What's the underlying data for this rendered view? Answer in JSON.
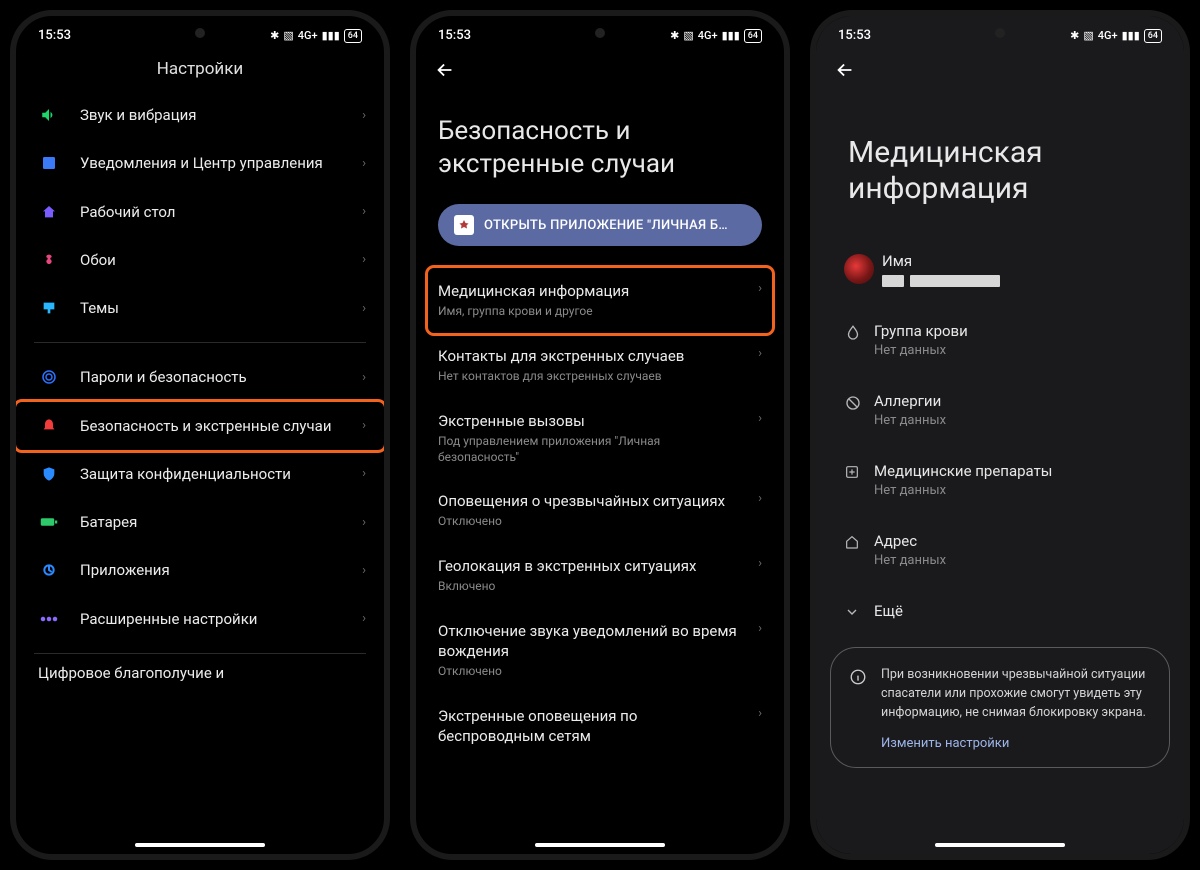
{
  "status": {
    "time": "15:53",
    "battery": "64",
    "net": "4G+"
  },
  "phone1": {
    "title": "Настройки",
    "items": [
      {
        "icon": "sound-icon",
        "color": "#1dd66a",
        "label": "Звук и вибрация"
      },
      {
        "icon": "notif-icon",
        "color": "#3a7af8",
        "label": "Уведомления и Центр управления"
      },
      {
        "icon": "home-icon",
        "color": "#7a5cff",
        "label": "Рабочий стол"
      },
      {
        "icon": "wallpaper-icon",
        "color": "#e6477f",
        "label": "Обои"
      },
      {
        "icon": "themes-icon",
        "color": "#29b6ff",
        "label": "Темы"
      }
    ],
    "items2": [
      {
        "icon": "fingerprint-icon",
        "color": "#2a72ff",
        "label": "Пароли и безопасность"
      },
      {
        "icon": "emergency-icon",
        "color": "#f23b3b",
        "label": "Безопасность и экстренные случаи",
        "highlight": true
      },
      {
        "icon": "shield-icon",
        "color": "#2a8aff",
        "label": "Защита конфиденциально­сти"
      },
      {
        "icon": "battery-icon",
        "color": "#2dc96a",
        "label": "Батарея"
      },
      {
        "icon": "apps-icon",
        "color": "#2a8aff",
        "label": "Приложения"
      },
      {
        "icon": "more-icon",
        "color": "#8b6bff",
        "label": "Расширенные настройки"
      }
    ],
    "cutoff": "Цифровое благополучие и"
  },
  "phone2": {
    "title": "Безопасность и экстренные случаи",
    "pill": "ОТКРЫТЬ ПРИЛОЖЕНИЕ \"ЛИЧНАЯ Б…",
    "items": [
      {
        "label": "Медицинская информация",
        "sub": "Имя, группа крови и другое",
        "highlight": true
      },
      {
        "label": "Контакты для экстренных случаев",
        "sub": "Нет контактов для экстренных случаев"
      },
      {
        "label": "Экстренные вызовы",
        "sub": "Под управлением приложения \"Личная безопасность\""
      },
      {
        "label": "Оповещения о чрезвычайных ситуациях",
        "sub": "Отключено"
      },
      {
        "label": "Геолокация в экстренных ситуациях",
        "sub": "Включено"
      },
      {
        "label": "Отключение звука уведомлений во время вождения",
        "sub": "Отключено"
      },
      {
        "label": "Экстренные оповещения по беспроводным сетям",
        "sub": ""
      }
    ]
  },
  "phone3": {
    "title": "Медицинская информация",
    "name_label": "Имя",
    "items": [
      {
        "icon": "blood-icon",
        "label": "Группа крови",
        "sub": "Нет данных"
      },
      {
        "icon": "allergy-icon",
        "label": "Аллергии",
        "sub": "Нет данных"
      },
      {
        "icon": "meds-icon",
        "label": "Медицинские препараты",
        "sub": "Нет данных"
      },
      {
        "icon": "address-icon",
        "label": "Адрес",
        "sub": "Нет данных"
      }
    ],
    "more": "Ещё",
    "notice": "При возникновении чрезвычайной ситуации спасатели или прохожие смогут увидеть эту информацию, не снимая блокировку экрана.",
    "notice_link": "Изменить настройки"
  }
}
